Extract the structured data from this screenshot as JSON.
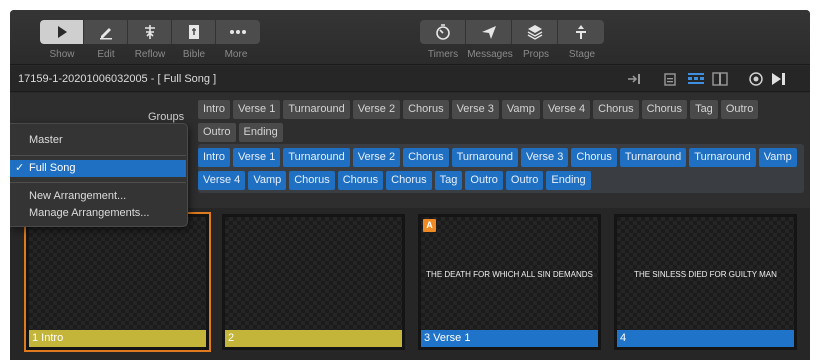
{
  "toolbar": {
    "left_buttons": [
      {
        "label": "Show",
        "icon": "play-icon",
        "active": true
      },
      {
        "label": "Edit",
        "icon": "pencil-icon",
        "active": false
      },
      {
        "label": "Reflow",
        "icon": "reflow-icon",
        "active": false
      },
      {
        "label": "Bible",
        "icon": "book-icon",
        "active": false
      },
      {
        "label": "More",
        "icon": "ellipsis-icon",
        "active": false
      }
    ],
    "right_buttons": [
      {
        "label": "Timers",
        "icon": "timer-icon"
      },
      {
        "label": "Messages",
        "icon": "send-icon"
      },
      {
        "label": "Props",
        "icon": "layers-icon"
      },
      {
        "label": "Stage",
        "icon": "stage-icon"
      }
    ]
  },
  "document": {
    "title": "17159-1-20201006032005 - [ Full Song ]"
  },
  "groups": {
    "label": "Groups",
    "items": [
      "Intro",
      "Verse 1",
      "Turnaround",
      "Verse 2",
      "Chorus",
      "Verse 3",
      "Vamp",
      "Verse 4",
      "Chorus",
      "Chorus",
      "Tag",
      "Outro",
      "Outro",
      "Ending"
    ]
  },
  "arrangement": {
    "items": [
      "Intro",
      "Verse 1",
      "Turnaround",
      "Verse 2",
      "Chorus",
      "Turnaround",
      "Verse 3",
      "Chorus",
      "Turnaround",
      "Turnaround",
      "Vamp",
      "Verse 4",
      "Vamp",
      "Chorus",
      "Chorus",
      "Chorus",
      "Tag",
      "Outro",
      "Outro",
      "Ending"
    ]
  },
  "menu": {
    "master": "Master",
    "selected": "Full Song",
    "check": "✓",
    "new_arrangement": "New Arrangement...",
    "manage_arrangements": "Manage Arrangements..."
  },
  "slides": [
    {
      "caption": "1 Intro",
      "text": "",
      "badge": "",
      "color": "yellow"
    },
    {
      "caption": "2",
      "text": "",
      "badge": "",
      "color": "yellow"
    },
    {
      "caption": "3 Verse 1",
      "text": "THE DEATH FOR WHICH ALL SIN DEMANDS",
      "badge": "A",
      "color": "blue"
    },
    {
      "caption": "4",
      "text": "THE SINLESS DIED FOR GUILTY MAN",
      "badge": "",
      "color": "blue"
    }
  ],
  "colors": {
    "accent_blue": "#1f6fc2",
    "selection_orange": "#e07a1f",
    "group_yellow": "#c3b43a"
  }
}
